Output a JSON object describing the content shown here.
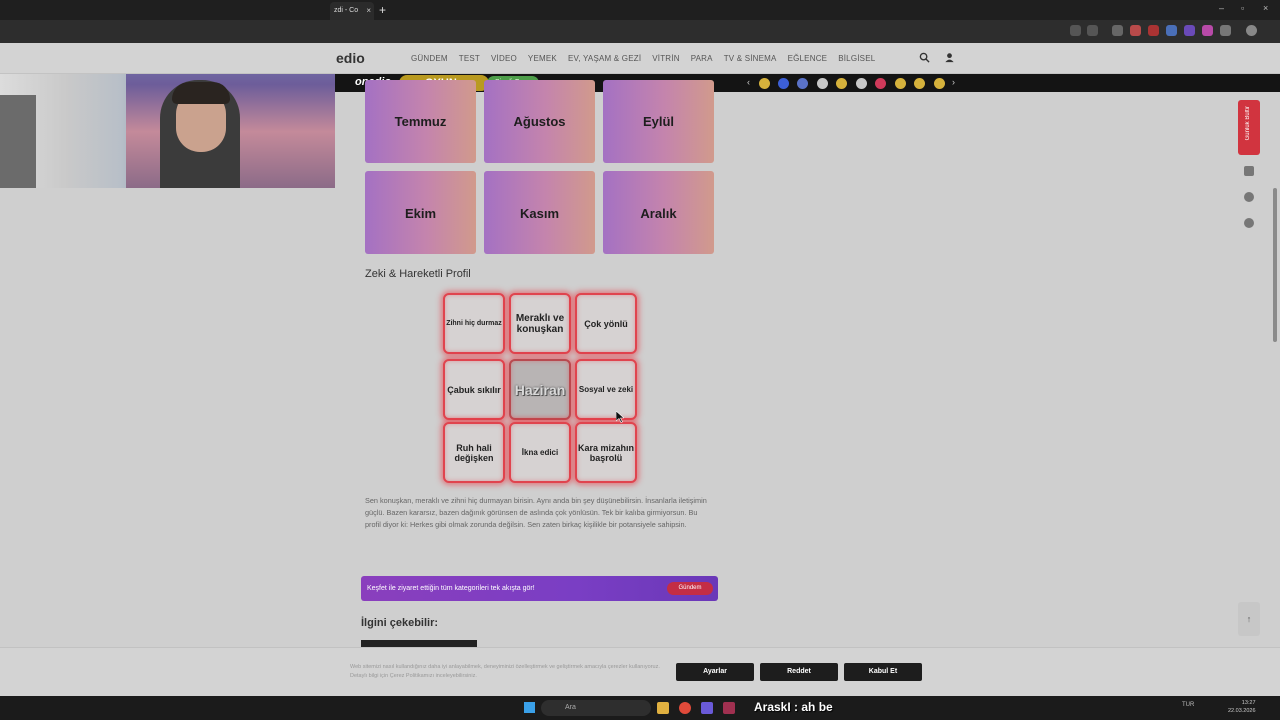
{
  "browser": {
    "tab_title": "zdi - Co",
    "tab_close": "×",
    "new_tab": "+",
    "window_controls": [
      "–",
      "▫",
      "×"
    ]
  },
  "site": {
    "logo": "edio",
    "nav": [
      "GÜNDEM",
      "TEST",
      "VİDEO",
      "YEMEK",
      "EV, YAŞAM & GEZİ",
      "VİTRİN",
      "PARA",
      "TV & SİNEMA",
      "EĞLENCE",
      "BİLGİSEL"
    ],
    "search_icon": "search-icon",
    "user_icon": "user-icon"
  },
  "game_bar": {
    "logo": "onedio",
    "badge": "OYUN",
    "play_label": "Şimdi Oyna",
    "prev": "‹",
    "next": "›",
    "icon_colors": [
      "#d6b23c",
      "#3c5fd6",
      "#5a72c8",
      "#c8c8c8",
      "#d6b23c",
      "#c8c8c8",
      "#d03a5a",
      "#d6b23c",
      "#d6b23c",
      "#d6b23c"
    ]
  },
  "months": [
    "Temmuz",
    "Ağustos",
    "Eylül",
    "Ekim",
    "Kasım",
    "Aralık"
  ],
  "section_title": "Zeki & Hareketli Profil",
  "bingo": [
    "Zihni hiç durmaz",
    "Meraklı ve konuşkan",
    "Çok yönlü",
    "Çabuk sıkılır",
    "Haziran",
    "Sosyal ve zeki",
    "Ruh hali değişken",
    "İkna edici",
    "Kara mizahın başrolü"
  ],
  "description": "Sen konuşkan, meraklı ve zihni hiç durmayan birisin. Aynı anda bin şey düşünebilirsin. İnsanlarla iletişimin güçlü. Bazen kararsız, bazen dağınık görünsen de aslında çok yönlüsün. Tek bir kalıba girmiyorsun. Bu profil diyor ki: Herkes gibi olmak zorunda değilsin. Sen zaten birkaç kişilikle bir potansiyele sahipsin.",
  "banner": {
    "text": "Keşfet ile ziyaret ettiğin tüm kategorileri tek akışta gör!",
    "button": "Gündem"
  },
  "might_like": "İlgini çekebilir:",
  "side": {
    "tab": "Günlük Bültir",
    "up_arrow": "↑"
  },
  "cookie": {
    "text": "Web sitemizi nasıl kullandığınız daha iyi anlayabilmek, deneyiminizi özelleştirmek ve geliştirmek amacıyla çerezler kullanıyoruz. Detaylı bilgi için Çerez Politikamızı inceleyebilirsiniz.",
    "buttons": [
      "Ayarlar",
      "Reddet",
      "Kabul Et"
    ]
  },
  "taskbar": {
    "search": "Ara",
    "chat": "AraskI : ah be",
    "tray": "TUR",
    "time": "13:27",
    "date": "22.03.2026"
  }
}
